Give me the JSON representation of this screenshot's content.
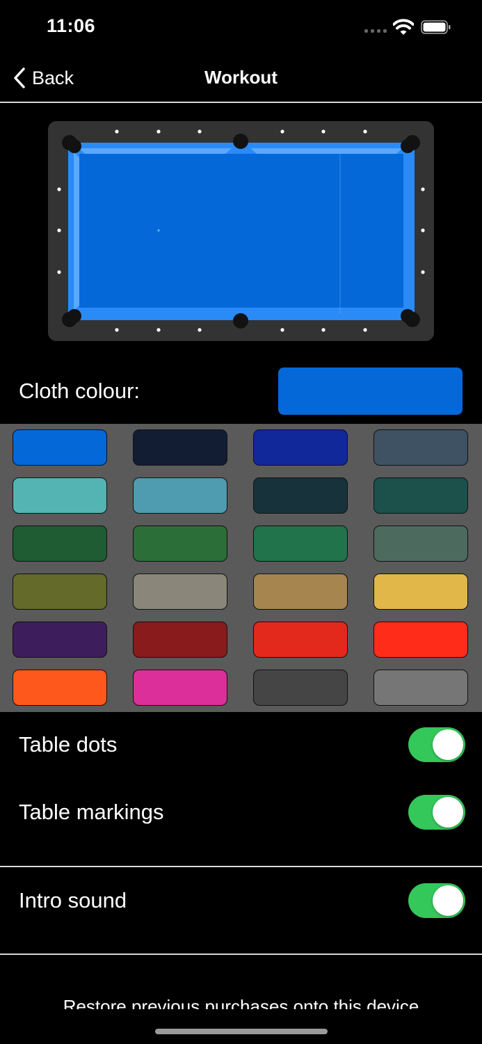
{
  "status": {
    "time": "11:06"
  },
  "nav": {
    "back_label": "Back",
    "title": "Workout"
  },
  "cloth": {
    "label": "Cloth colour:",
    "selected_color": "#0468d8"
  },
  "palette": [
    "#0468d8",
    "#121d33",
    "#10289a",
    "#3e5264",
    "#53b4b3",
    "#4f9bb0",
    "#17323b",
    "#1b514a",
    "#1f5c33",
    "#2c6e37",
    "#20734b",
    "#4d6a5e",
    "#636a2a",
    "#8a877a",
    "#a6854f",
    "#e2b74a",
    "#3e1d5c",
    "#891b1c",
    "#e3291c",
    "#ff2c1a",
    "#ff581d",
    "#dc2f99",
    "#454545",
    "#767676"
  ],
  "settings": {
    "table_dots": {
      "label": "Table dots",
      "on": true
    },
    "table_markings": {
      "label": "Table markings",
      "on": true
    },
    "intro_sound": {
      "label": "Intro sound",
      "on": true
    }
  },
  "toggle_on_color": "#34c759",
  "footer": {
    "restore_text": "Restore previous purchases onto this device"
  }
}
